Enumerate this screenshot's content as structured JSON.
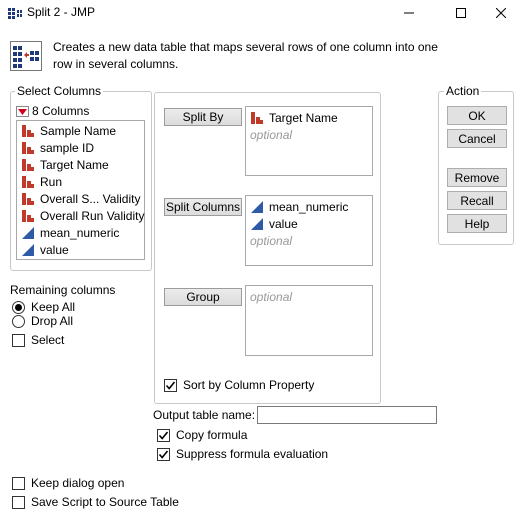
{
  "window": {
    "title": "Split 2 - JMP",
    "icon": "jmp-split-icon",
    "controls": [
      "minimize-icon",
      "maximize-icon",
      "close-icon"
    ]
  },
  "description": "Creates a new data table that maps several rows of one column into one row in several columns.",
  "select_columns": {
    "legend": "Select Columns",
    "count_label": "8 Columns",
    "columns": [
      {
        "name": "Sample Name",
        "type": "nominal"
      },
      {
        "name": "sample ID",
        "type": "nominal"
      },
      {
        "name": "Target Name",
        "type": "nominal"
      },
      {
        "name": "Run",
        "type": "nominal"
      },
      {
        "name": "Overall S... Validity",
        "type": "nominal"
      },
      {
        "name": "Overall Run Validity",
        "type": "nominal"
      },
      {
        "name": "mean_numeric",
        "type": "continuous"
      },
      {
        "name": "value",
        "type": "continuous"
      }
    ]
  },
  "remaining_columns": {
    "label": "Remaining columns",
    "options": [
      "Keep All",
      "Drop All"
    ],
    "selected": "Keep All",
    "select_label": "Select",
    "select_checked": false
  },
  "roles": {
    "split_by": {
      "label": "Split By",
      "items": [
        "Target Name"
      ],
      "placeholder": "optional"
    },
    "split_columns": {
      "label": "Split Columns",
      "items": [
        "mean_numeric",
        "value"
      ],
      "placeholder": "optional"
    },
    "group": {
      "label": "Group",
      "items": [],
      "placeholder": "optional"
    },
    "sort_by_column_property": {
      "label": "Sort by Column Property",
      "checked": true
    }
  },
  "action": {
    "legend": "Action",
    "buttons": [
      "OK",
      "Cancel",
      "Remove",
      "Recall",
      "Help"
    ]
  },
  "output": {
    "label": "Output table name:",
    "value": "",
    "copy_formula": {
      "label": "Copy formula",
      "checked": true
    },
    "suppress_formula": {
      "label": "Suppress formula evaluation",
      "checked": true
    }
  },
  "footer": {
    "keep_dialog_open": {
      "label": "Keep dialog open",
      "checked": false
    },
    "save_script": {
      "label": "Save Script to Source Table",
      "checked": false
    }
  },
  "colors": {
    "nominal_icon": "#c0392b",
    "continuous_icon": "#2e5aa8"
  }
}
